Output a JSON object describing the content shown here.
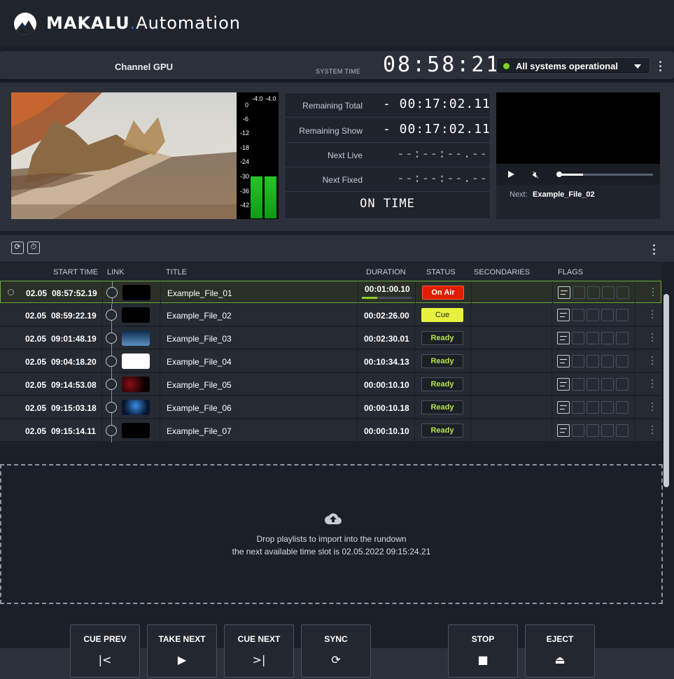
{
  "app": {
    "brand_name": "MAKALU",
    "brand_dot": ".",
    "brand_product": "Automation"
  },
  "channel": {
    "name": "Channel GPU",
    "system_time_label": "SYSTEM TIME",
    "system_time": "08:58:21",
    "status": "All systems operational",
    "status_color": "#7dd321"
  },
  "audio_meter": {
    "channel_labels": [
      "-4.0",
      "-4.0"
    ],
    "scale": [
      "0",
      "-6",
      "-12",
      "-18",
      "-24",
      "-30",
      "-36",
      "-42"
    ]
  },
  "timers": [
    {
      "label": "Remaining Total",
      "value": "- 00:17:02.11"
    },
    {
      "label": "Remaining Show",
      "value": "- 00:17:02.11"
    },
    {
      "label": "Next Live",
      "value": "--:--:--.--"
    },
    {
      "label": "Next Fixed",
      "value": "--:--:--.--"
    }
  ],
  "timing_state": "ON TIME",
  "player": {
    "next_label": "Next:",
    "next_value": "Example_File_02",
    "seek_progress": 0.25
  },
  "columns": {
    "start_time": "START TIME",
    "link": "LINK",
    "title": "TITLE",
    "duration": "DURATION",
    "status": "STATUS",
    "secondaries": "SECONDARIES",
    "flags": "FLAGS"
  },
  "rows": [
    {
      "date": "02.05",
      "start": "08:57:52.19",
      "title": "Example_File_01",
      "duration": "00:01:00.10",
      "status": "On Air",
      "progress": 0.3
    },
    {
      "date": "02.05",
      "start": "08:59:22.19",
      "title": "Example_File_02",
      "duration": "00:02:26.00",
      "status": "Cue"
    },
    {
      "date": "02.05",
      "start": "09:01:48.19",
      "title": "Example_File_03",
      "duration": "00:02:30.01",
      "status": "Ready"
    },
    {
      "date": "02.05",
      "start": "09:04:18.20",
      "title": "Example_File_04",
      "duration": "00:10:34.13",
      "status": "Ready"
    },
    {
      "date": "02.05",
      "start": "09:14:53.08",
      "title": "Example_File_05",
      "duration": "00:00:10.10",
      "status": "Ready"
    },
    {
      "date": "02.05",
      "start": "09:15:03.18",
      "title": "Example_File_06",
      "duration": "00:00:10.18",
      "status": "Ready"
    },
    {
      "date": "02.05",
      "start": "09:15:14.11",
      "title": "Example_File_07",
      "duration": "00:00:10.10",
      "status": "Ready"
    }
  ],
  "dropzone": {
    "line1": "Drop playlists to import into the rundown",
    "line2": "the next available time slot is 02.05.2022 09:15:24.21"
  },
  "controls": [
    {
      "label": "CUE PREV",
      "icon": "|<"
    },
    {
      "label": "TAKE NEXT",
      "icon": "▶"
    },
    {
      "label": "CUE NEXT",
      "icon": ">|"
    },
    {
      "label": "SYNC",
      "icon": "⟳"
    },
    {
      "label": "STOP",
      "icon": "■"
    },
    {
      "label": "EJECT",
      "icon": "⏏"
    }
  ]
}
